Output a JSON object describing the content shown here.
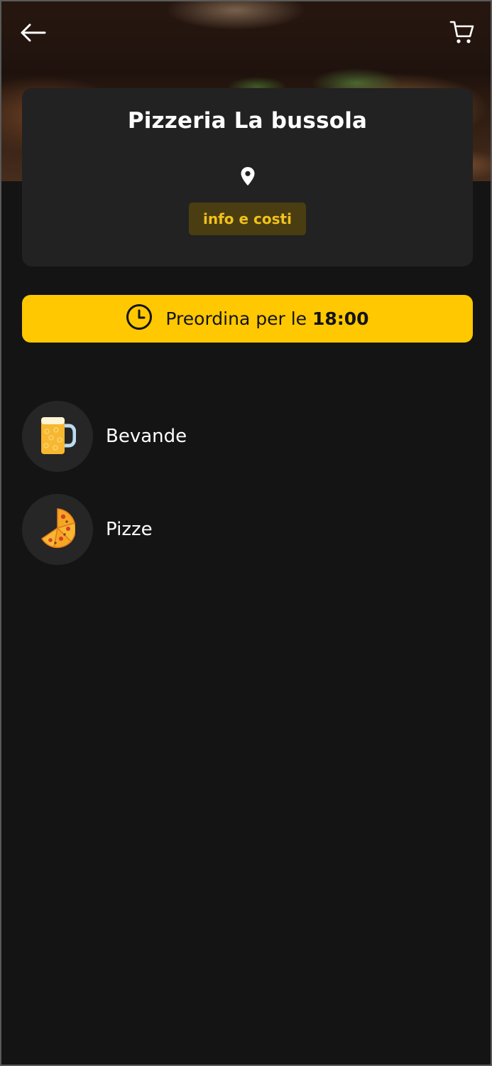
{
  "header": {
    "back_icon": "arrow-left-icon",
    "cart_icon": "cart-icon"
  },
  "restaurant": {
    "name": "Pizzeria La bussola",
    "location_icon": "map-pin-icon",
    "info_button_label": "info e costi"
  },
  "preorder": {
    "icon": "clock-icon",
    "label_prefix": "Preordina per le",
    "time": "18:00"
  },
  "categories": [
    {
      "label": "Bevande",
      "icon": "beer-mug-icon"
    },
    {
      "label": "Pizze",
      "icon": "pizza-slices-icon"
    }
  ],
  "colors": {
    "background": "#141414",
    "card": "#222222",
    "accent": "#ffc800",
    "info_button_bg": "#4a3d12",
    "info_button_text": "#f2c21b"
  }
}
